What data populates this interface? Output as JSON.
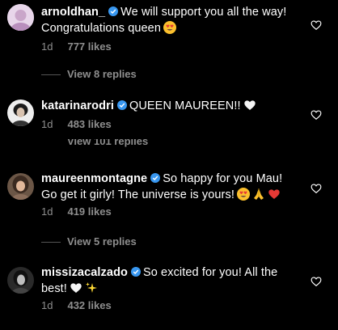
{
  "comments": [
    {
      "username": "arnoldhan_",
      "text": "We will support you all the way! Congratulations queen",
      "time": "1d",
      "likes": "777 likes"
    },
    {
      "username": "katarinarodri",
      "text": "QUEEN MAUREEN!!",
      "time": "1d",
      "likes": "483 likes"
    },
    {
      "username": "maureenmontagne",
      "text": "So happy for you Mau! Go get it girly! The universe is yours!",
      "time": "1d",
      "likes": "419 likes"
    },
    {
      "username": "missizacalzado",
      "text": "So excited for you! All the best!",
      "time": "1d",
      "likes": "432 likes"
    }
  ],
  "replies": [
    "View 8 replies",
    "View 101 replies",
    "View 5 replies"
  ],
  "icons": {
    "verified": "verified-badge-icon",
    "like": "heart-outline-icon"
  },
  "colors": {
    "background": "#000000",
    "verified": "#3897f0",
    "secondary_text": "#8e8e8e"
  }
}
